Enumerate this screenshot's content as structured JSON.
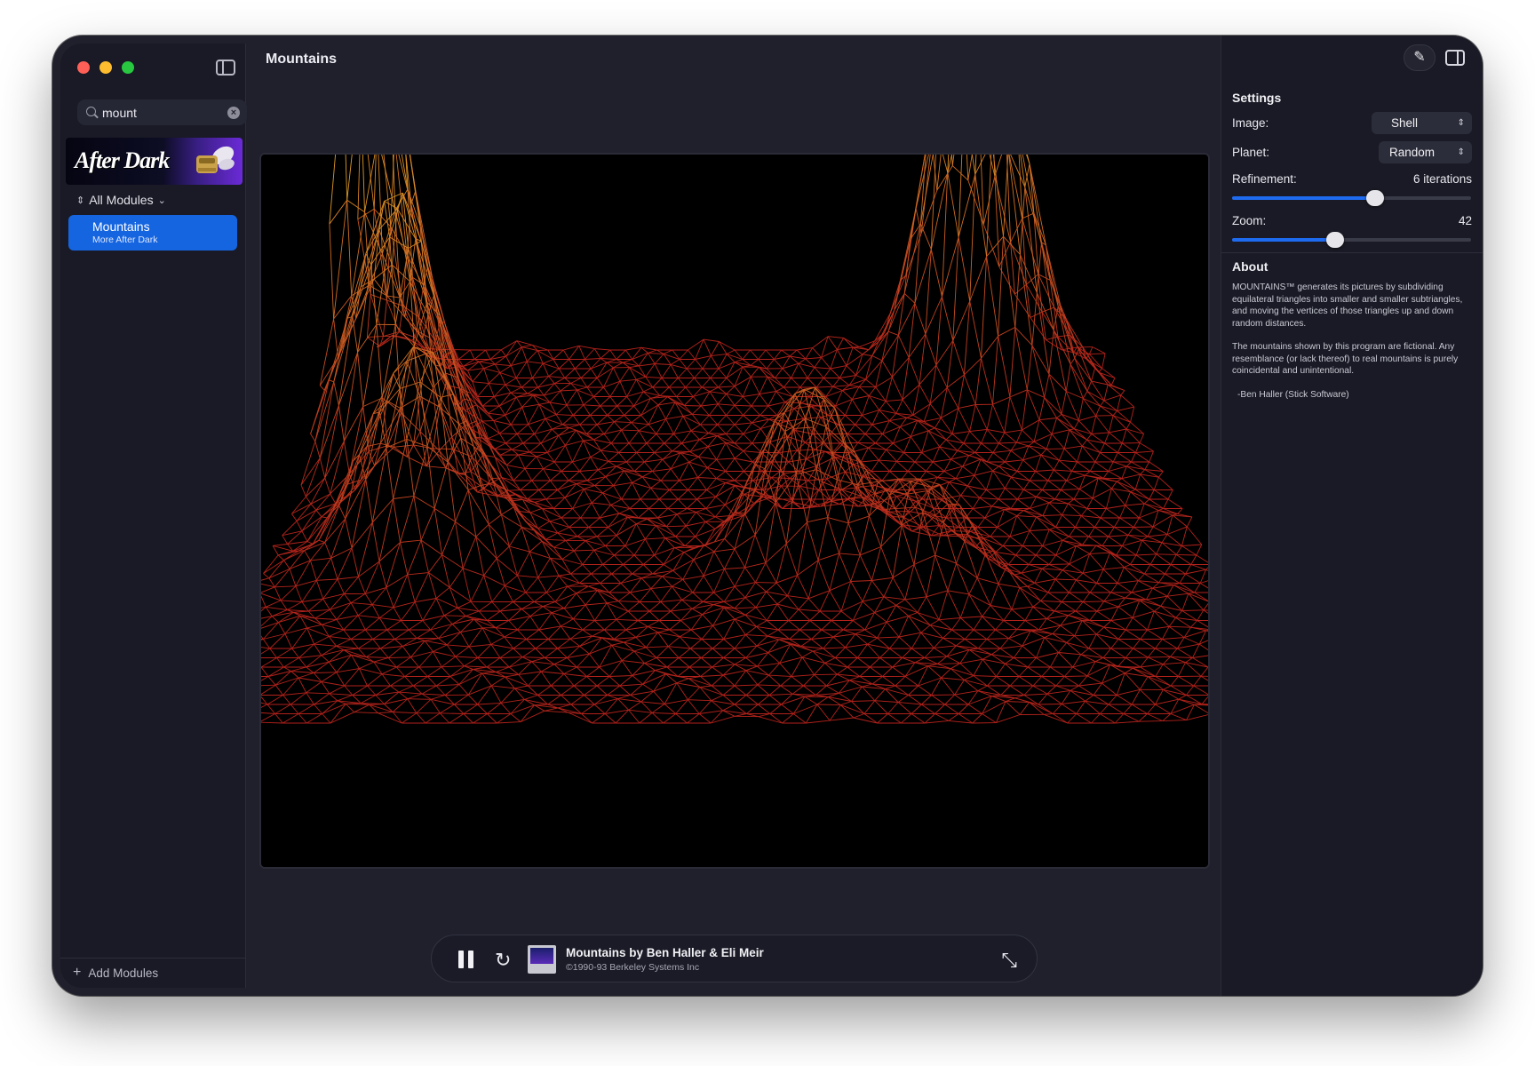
{
  "window": {
    "title": "Mountains"
  },
  "sidebar": {
    "search": {
      "value": "mount",
      "placeholder": "Search"
    },
    "banner_text": "After Dark",
    "filter_label": "All Modules",
    "items": [
      {
        "title": "Mountains",
        "subtitle": "More After Dark",
        "selected": true
      }
    ],
    "add_label": "Add Modules"
  },
  "player": {
    "title": "Mountains by Ben Haller & Eli Meir",
    "subtitle": "©1990-93 Berkeley Systems Inc"
  },
  "inspector": {
    "settings_title": "Settings",
    "image_label": "Image:",
    "image_value": "Shell",
    "planet_label": "Planet:",
    "planet_value": "Random",
    "refinement_label": "Refinement:",
    "refinement_value": "6 iterations",
    "refinement_level": 0.6,
    "zoom_label": "Zoom:",
    "zoom_value": "42",
    "zoom_level": 0.43,
    "about_title": "About",
    "about_p1": "MOUNTAINS™ generates its pictures by subdividing equilateral triangles into smaller and smaller subtriangles, and moving the vertices of those triangles up and down random distances.",
    "about_p2": "The mountains shown by this program are fictional. Any resemblance (or lack thereof) to real mountains is purely coincidental and unintentional.",
    "about_credit": "-Ben Haller  (Stick Software)"
  },
  "colors": {
    "accent": "#1565e0",
    "window_bg": "#1f202c",
    "sidebar_bg": "#191a25",
    "terrain_low": "#b3211b",
    "terrain_high": "#e0a22a"
  },
  "icons": {
    "search": "search-icon",
    "clear": "clear-search-icon",
    "sidebar_toggle": "sidebar-toggle-icon",
    "pause": "pause-icon",
    "restart": "refresh-icon",
    "expand": "expand-icon",
    "eyedropper": "eyedropper-icon",
    "inspector_toggle": "inspector-toggle-icon"
  }
}
